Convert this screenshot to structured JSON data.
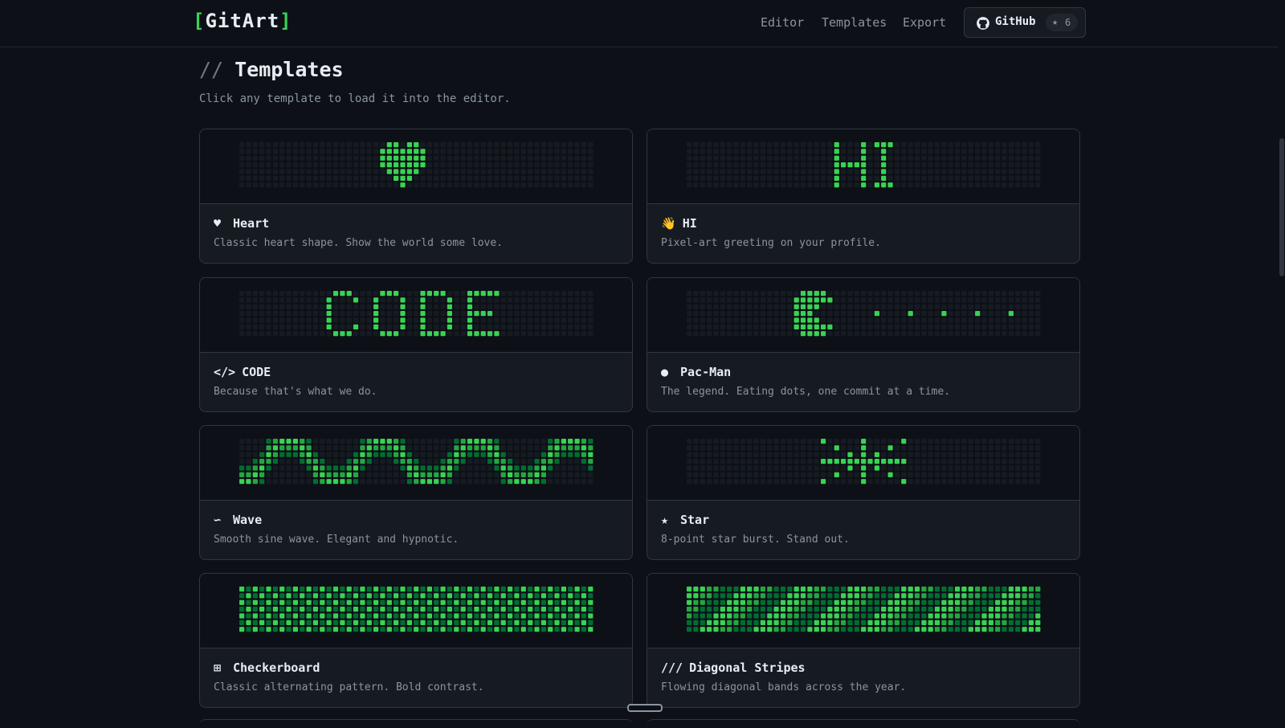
{
  "header": {
    "logo_open": "[",
    "logo_text": "GitArt",
    "logo_close": "]",
    "nav": [
      {
        "label": "Editor"
      },
      {
        "label": "Templates"
      },
      {
        "label": "Export"
      }
    ],
    "github": {
      "label": "GitHub",
      "stars": "6"
    }
  },
  "page": {
    "slashes": "//",
    "title": "Templates",
    "subtitle": "Click any template to load it into the editor."
  },
  "colors": {
    "background": "#0d1117",
    "card": "#161b22",
    "border": "#30363d",
    "cell_empty": "#161b22",
    "cell_on": "#39d353",
    "cell_mid": "#26a641",
    "cell_dim": "#006d32"
  },
  "templates": [
    {
      "icon": "heart-icon",
      "glyph": "♥",
      "name": "Heart",
      "description": "Classic heart shape. Show the world some love."
    },
    {
      "icon": "waving-hand-icon",
      "glyph": "👋",
      "name": "HI",
      "description": "Pixel-art greeting on your profile."
    },
    {
      "icon": "code-icon",
      "glyph": "</>",
      "name": "CODE",
      "description": "Because that's what we do."
    },
    {
      "icon": "dot-icon",
      "glyph": "●",
      "name": "Pac-Man",
      "description": "The legend. Eating dots, one commit at a time."
    },
    {
      "icon": "wave-icon",
      "glyph": "∽",
      "name": "Wave",
      "description": "Smooth sine wave. Elegant and hypnotic."
    },
    {
      "icon": "star-icon",
      "glyph": "★",
      "name": "Star",
      "description": "8-point star burst. Stand out."
    },
    {
      "icon": "grid-icon",
      "glyph": "⊞",
      "name": "Checkerboard",
      "description": "Classic alternating pattern. Bold contrast."
    },
    {
      "icon": "slashes-icon",
      "glyph": "///",
      "name": "Diagonal Stripes",
      "description": "Flowing diagonal bands across the year."
    }
  ]
}
